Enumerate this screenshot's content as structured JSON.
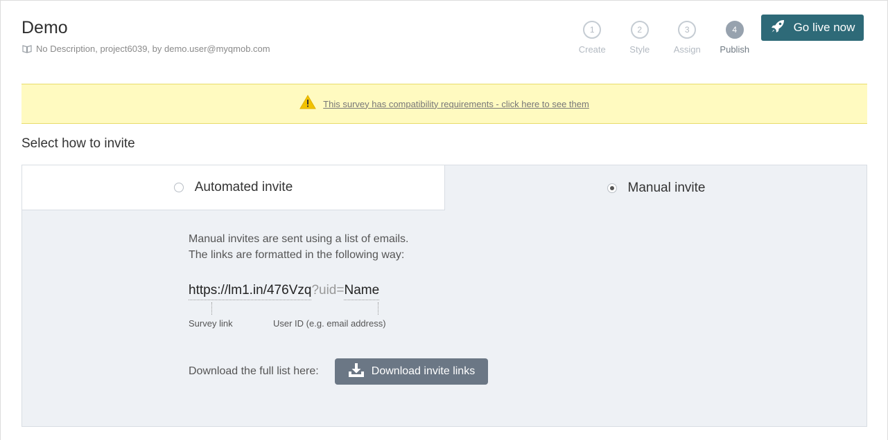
{
  "header": {
    "title": "Demo",
    "subtitle": "No Description, project6039, by demo.user@myqmob.com",
    "subtitle_icon": "book-icon"
  },
  "steps": [
    {
      "num": "1",
      "label": "Create",
      "active": false
    },
    {
      "num": "2",
      "label": "Style",
      "active": false
    },
    {
      "num": "3",
      "label": "Assign",
      "active": false
    },
    {
      "num": "4",
      "label": "Publish",
      "active": true
    }
  ],
  "go_live": {
    "label": "Go live now",
    "icon": "rocket-icon"
  },
  "banner": {
    "text": "This survey has compatibility requirements - click here to see them",
    "icon": "warning-icon"
  },
  "section_title": "Select how to invite",
  "tabs": {
    "automated": {
      "label": "Automated invite",
      "selected": false
    },
    "manual": {
      "label": "Manual invite",
      "selected": true
    }
  },
  "manual": {
    "line1": "Manual invites are sent using a list of emails.",
    "line2": "The links are formatted in the following way:",
    "url_link": "https://lm1.in/476Vzq",
    "url_param": "?uid=",
    "url_name": "Name",
    "caption_link": "Survey link",
    "caption_user": "User ID (e.g. email address)",
    "download_label": "Download the full list here:",
    "download_button": "Download invite links",
    "download_icon": "download-icon"
  },
  "colors": {
    "primary": "#2e6a78",
    "banner_bg": "#fffac0",
    "panel_bg": "#eef1f5",
    "download_btn": "#6b7785",
    "step_active": "#97a2ae"
  }
}
